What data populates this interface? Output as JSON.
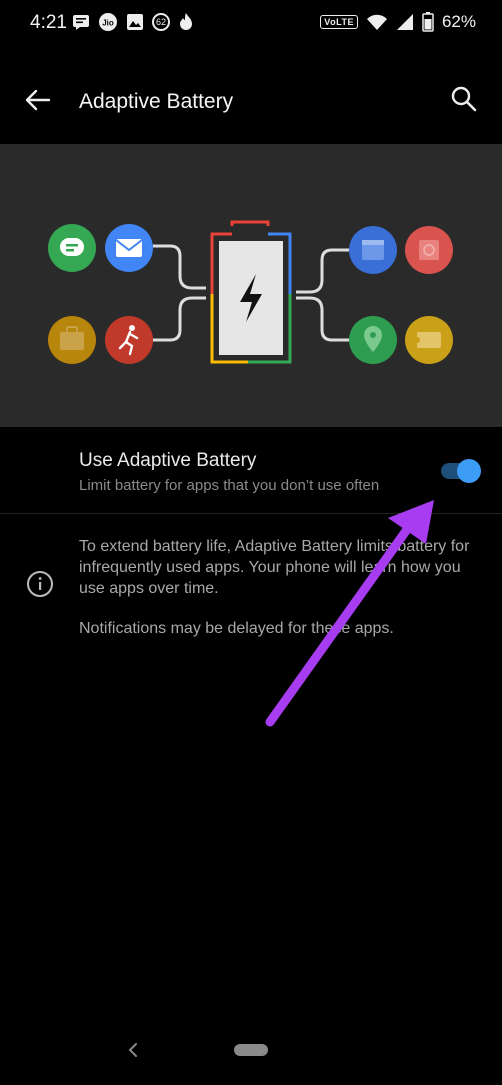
{
  "status_bar": {
    "time": "4:21",
    "network_label": "VoLTE",
    "battery_percent": "62%",
    "notification_badge": "62",
    "icons": [
      "message-icon",
      "jio-icon",
      "image-icon",
      "notification-badge",
      "fire-icon",
      "wifi-icon",
      "signal-icon",
      "battery-icon"
    ]
  },
  "app_bar": {
    "title": "Adaptive Battery",
    "back_icon": "arrow-left-icon",
    "search_icon": "search-icon"
  },
  "illustration": {
    "left_apps": [
      "chat-icon",
      "mail-icon",
      "briefcase-icon",
      "running-icon"
    ],
    "right_apps": [
      "calendar-icon",
      "fingerprint-icon",
      "maps-icon",
      "ticket-icon"
    ],
    "center": "battery-bolt-icon"
  },
  "setting": {
    "title": "Use Adaptive Battery",
    "summary": "Limit battery for apps that you don’t use often",
    "enabled": true,
    "accent_color": "#3d9cf5"
  },
  "info": {
    "icon": "info-icon",
    "paragraph_1": "To extend battery life, Adaptive Battery limits battery for infrequently used apps. Your phone will learn how you use apps over time.",
    "paragraph_2": "Notifications may be delayed for these apps."
  },
  "nav_bar": {
    "back_icon": "nav-back-icon",
    "home_icon": "home-pill-icon"
  },
  "annotation_color": "#a83cf0"
}
